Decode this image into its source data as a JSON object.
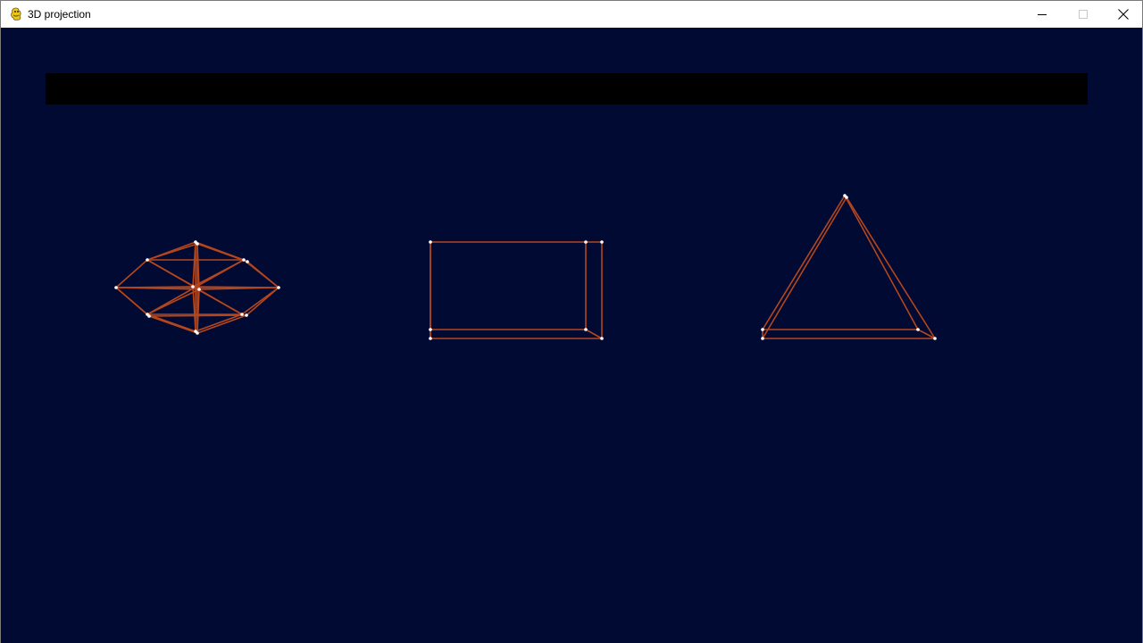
{
  "window": {
    "title": "3D projection",
    "app_icon": "pygame-snake-icon",
    "controls": {
      "minimize_icon": "minimize-icon",
      "maximize_icon": "maximize-icon",
      "close_icon": "close-icon"
    }
  },
  "scene": {
    "background_color": "#000a32",
    "header_bar_color": "#000000",
    "edge_color": "#b4461e",
    "vertex_color": "#ffffff",
    "objects": [
      {
        "shape": "octahedron-like polyhedron"
      },
      {
        "shape": "cuboid"
      },
      {
        "shape": "triangular prism"
      }
    ]
  }
}
